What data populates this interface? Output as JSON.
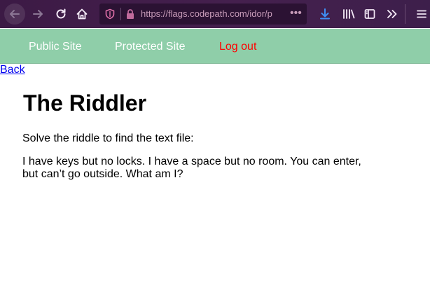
{
  "browser": {
    "url": "https://flags.codepath.com/idor/p",
    "url_overflow": "•••",
    "toolbar_icons": [
      "back-arrow-icon",
      "forward-arrow-icon",
      "reload-icon",
      "home-icon",
      "shield-icon",
      "lock-icon",
      "download-icon",
      "library-icon",
      "sidebar-icon",
      "overflow-chevron-icon",
      "hamburger-menu-icon"
    ],
    "colors": {
      "toolbar": "#45204e",
      "url_text": "#c79bb8",
      "download_icon": "#3f8ff5"
    }
  },
  "nav": {
    "public_site": "Public Site",
    "protected_site": "Protected Site",
    "log_out": "Log out",
    "colors": {
      "background": "#8fcea9",
      "link": "#ffffff",
      "logout": "#ff0000"
    }
  },
  "page": {
    "back_link": "Back",
    "title": "The Riddler",
    "intro": "Solve the riddle to find the text file:",
    "riddle": "I have keys but no locks. I have a space but no room. You can enter, but can’t go outside. What am I?"
  }
}
